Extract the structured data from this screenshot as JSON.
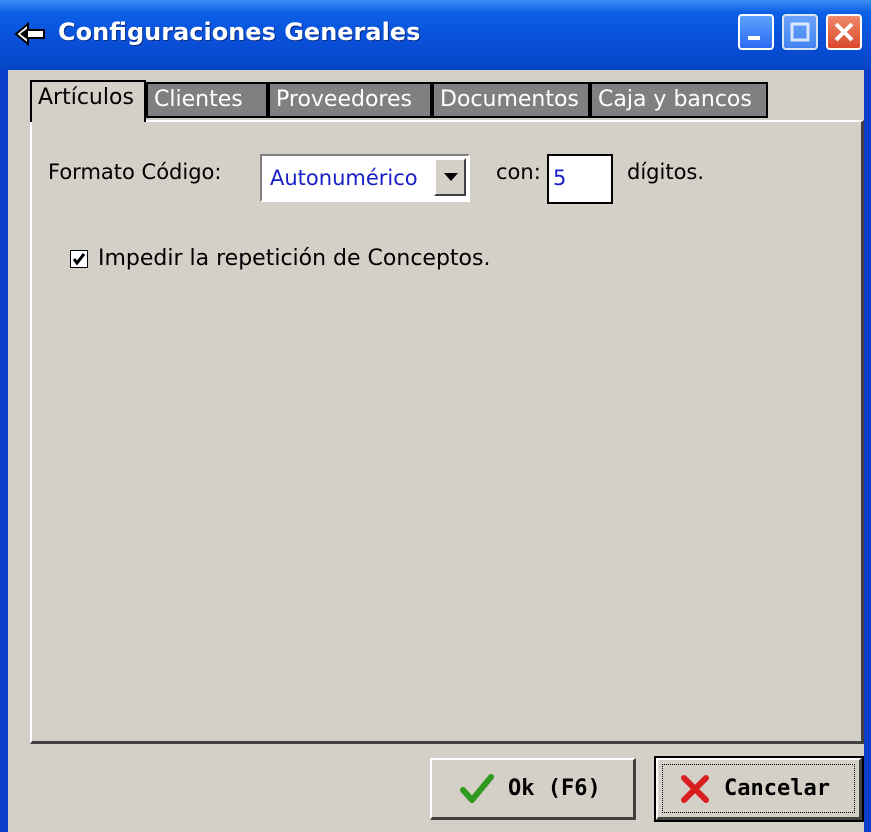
{
  "window": {
    "title": "Configuraciones Generales",
    "buttons": [
      "minimize-icon",
      "maximize-icon",
      "close-icon"
    ]
  },
  "tabs": [
    {
      "label": "Artículos",
      "active": true
    },
    {
      "label": "Clientes",
      "active": false
    },
    {
      "label": "Proveedores",
      "active": false
    },
    {
      "label": "Documentos",
      "active": false
    },
    {
      "label": "Caja y bancos",
      "active": false
    }
  ],
  "form": {
    "formato_label": "Formato Código:",
    "formato_value": "Autonumérico",
    "con_label": "con:",
    "digits_value": "5",
    "digits_label": "dígitos.",
    "checkbox_label": "Impedir la repetición de Conceptos.",
    "checkbox_checked": true
  },
  "footer": {
    "ok_label": "Ok (F6)",
    "cancel_label": "Cancelar"
  },
  "colors": {
    "titlebar": "#0a4fd8",
    "input_text": "#1a20c8",
    "face": "#d4d0c8"
  }
}
